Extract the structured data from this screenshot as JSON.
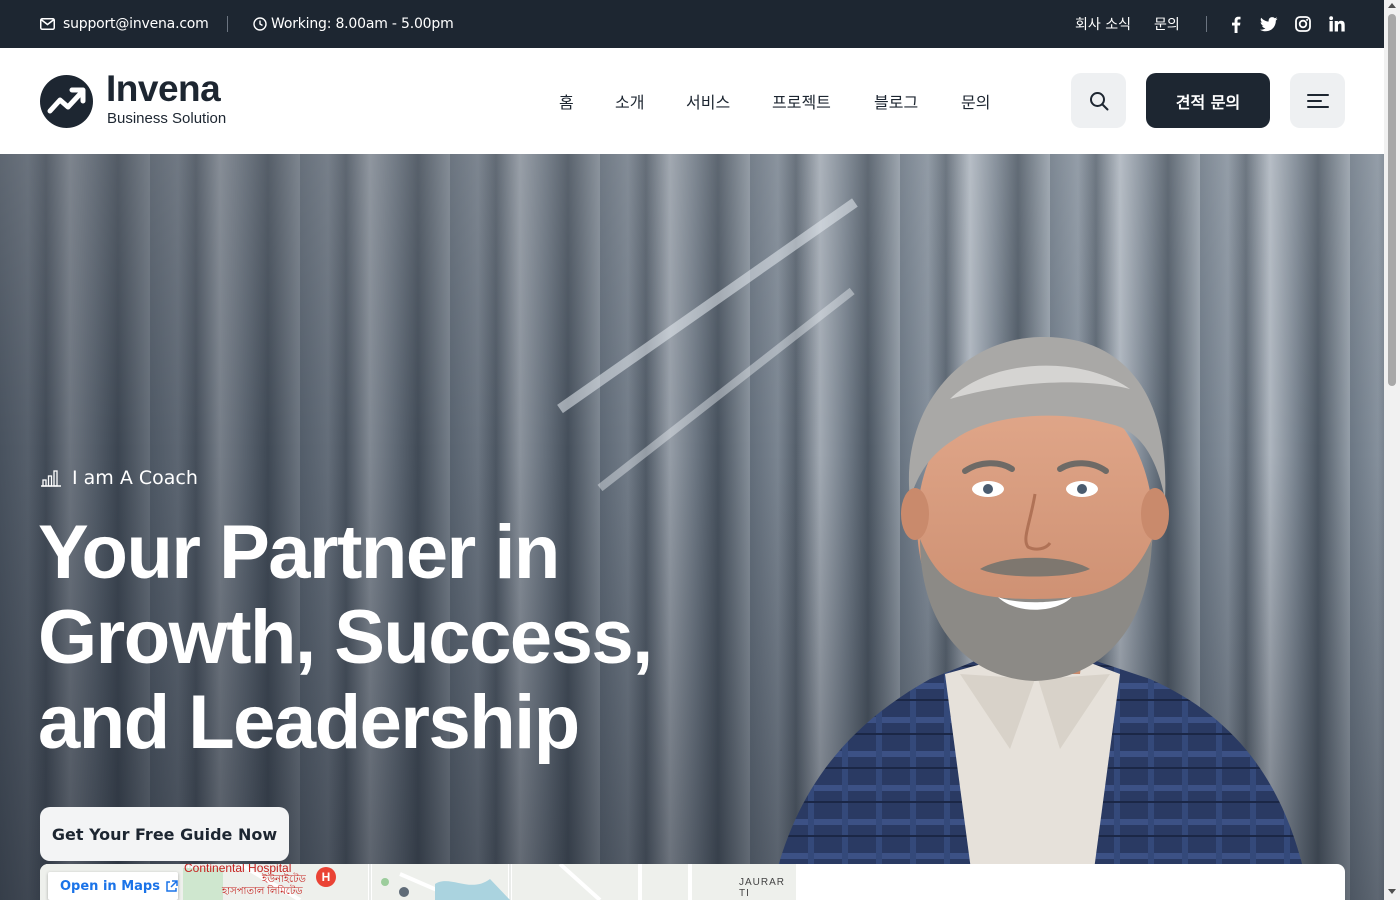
{
  "topbar": {
    "email": "support@invena.com",
    "hours": "Working: 8.00am - 5.00pm",
    "links": [
      "회사 소식",
      "문의"
    ],
    "social_icons": [
      "facebook-icon",
      "twitter-icon",
      "instagram-icon",
      "linkedin-icon"
    ],
    "background": "#1d2631"
  },
  "header": {
    "logo": {
      "name": "Invena",
      "tagline": "Business Solution"
    },
    "nav": [
      "홈",
      "소개",
      "서비스",
      "프로젝트",
      "블로그",
      "문의"
    ],
    "quote_button": "견적 문의",
    "icons": [
      "search-icon",
      "hamburger-menu-icon"
    ]
  },
  "hero": {
    "kicker": "I am A Coach",
    "headline": [
      "Your Partner in",
      "Growth, Success,",
      "and Leadership"
    ],
    "cta": "Get Your Free Guide Now"
  },
  "map": {
    "open_link": "Open in Maps",
    "hospital_label": "Continental Hospital",
    "hospital_sub1": "ইউনাইটেড",
    "hospital_sub2": "হাসপাতাল লিমিটেড",
    "road_label": "JAURAR TI"
  },
  "colors": {
    "brand_dark": "#1d2631",
    "button_light": "#eef0f2",
    "map_link": "#1a73e8"
  }
}
